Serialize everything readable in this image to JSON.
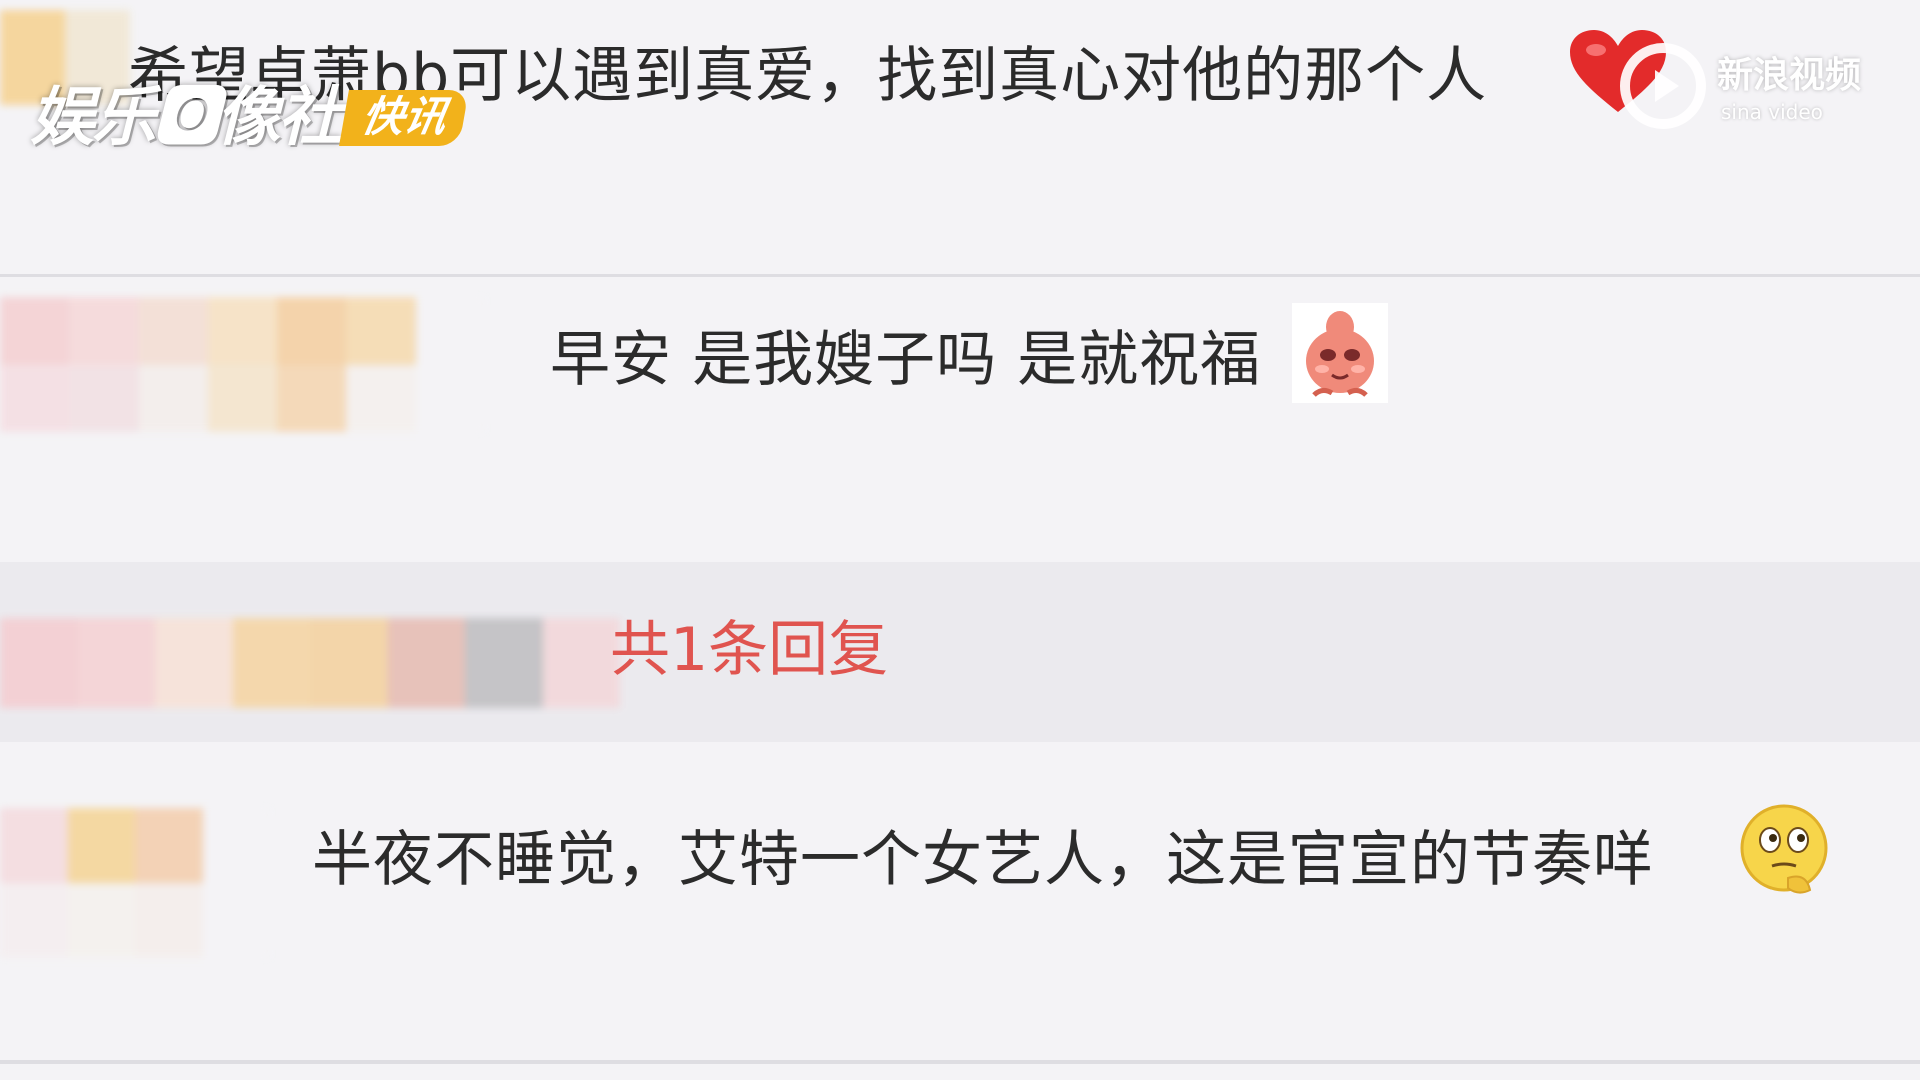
{
  "comments": [
    {
      "text": "希望卓萧bb可以遇到真爱，找到真心对他的那个人",
      "emoji": "red-heart-icon"
    },
    {
      "text": "早安 是我嫂子吗 是就祝福",
      "emoji": "shy-pink-blob-emoji-icon"
    },
    {
      "text": "半夜不睡觉，艾特一个女艺人，这是官宣的节奏咩",
      "emoji": "thinking-face-emoji-icon"
    }
  ],
  "reply": {
    "label": "共1条回复"
  },
  "watermark_left": {
    "title": "娱乐🅾像社",
    "badge": "快讯"
  },
  "watermark_right": {
    "title": "新浪视频",
    "subtitle": "sina video"
  },
  "colors": {
    "background": "#f4f3f6",
    "text": "#2b2b2b",
    "reply_link": "#e0544f",
    "reply_band": "#ebeaee",
    "badge": "#f2b21b"
  }
}
